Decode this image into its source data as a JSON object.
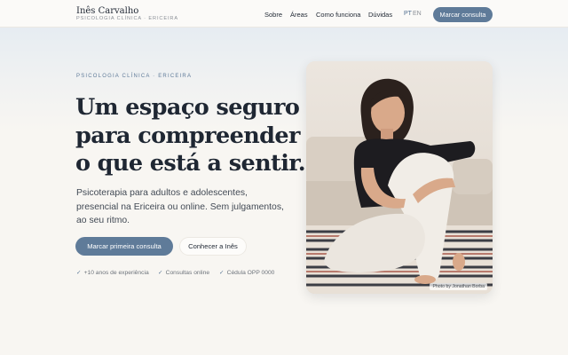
{
  "header": {
    "brand_name": "Inês Carvalho",
    "brand_subtitle": "PSICOLOGIA CLÍNICA · ERICEIRA",
    "nav": [
      "Sobre",
      "Áreas",
      "Como funciona",
      "Dúvidas"
    ],
    "lang_active": "PT",
    "lang_other": "EN",
    "cta": "Marcar consulta"
  },
  "hero": {
    "eyebrow": "PSICOLOGIA CLÍNICA · ERICEIRA",
    "headline": [
      "Um espaço seguro",
      "para compreender",
      "o que está a sentir."
    ],
    "description": [
      "Psicoterapia para adultos e adolescentes,",
      "presencial na Ericeira ou online. Sem julgamentos,",
      "ao seu ritmo."
    ],
    "primary_button": "Marcar primeira consulta",
    "secondary_button": "Conhecer a Inês",
    "features": [
      "+10 anos de experiência",
      "Consultas online",
      "Cédula OPP 0000"
    ],
    "check_icon": "✓"
  },
  "photo": {
    "credit": "Photo by Jonathan Borba"
  },
  "colors": {
    "accent": "#5f7b99",
    "background": "#f8f6f2",
    "text": "#1f2733"
  }
}
